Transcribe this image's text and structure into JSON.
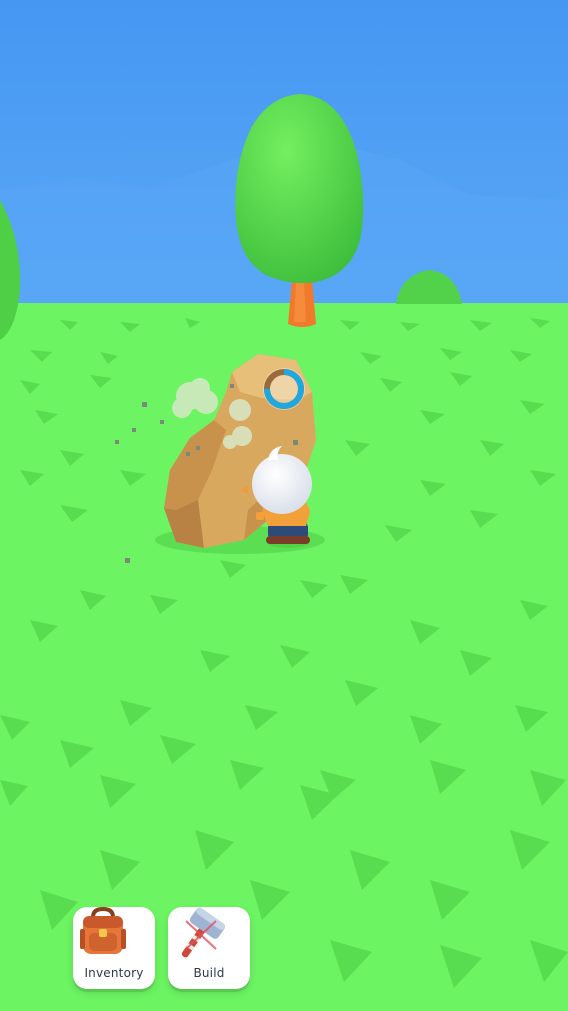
{
  "hud": {
    "buttons": [
      {
        "id": "inventory",
        "label": "Inventory",
        "icon": "backpack-icon"
      },
      {
        "id": "build",
        "label": "Build",
        "icon": "hammer-icon"
      }
    ]
  },
  "world": {
    "action_progress": 0.75,
    "colors": {
      "sky": "#4a9cf4",
      "grass": "#6cf462",
      "grass_marks": "#4fd448",
      "tree_foliage": "#5cdc4e",
      "tree_trunk": "#f07a2a",
      "rock": "#d9a85f",
      "progress_fill": "#1fa7e0",
      "progress_track": "#9a6a3c"
    }
  }
}
